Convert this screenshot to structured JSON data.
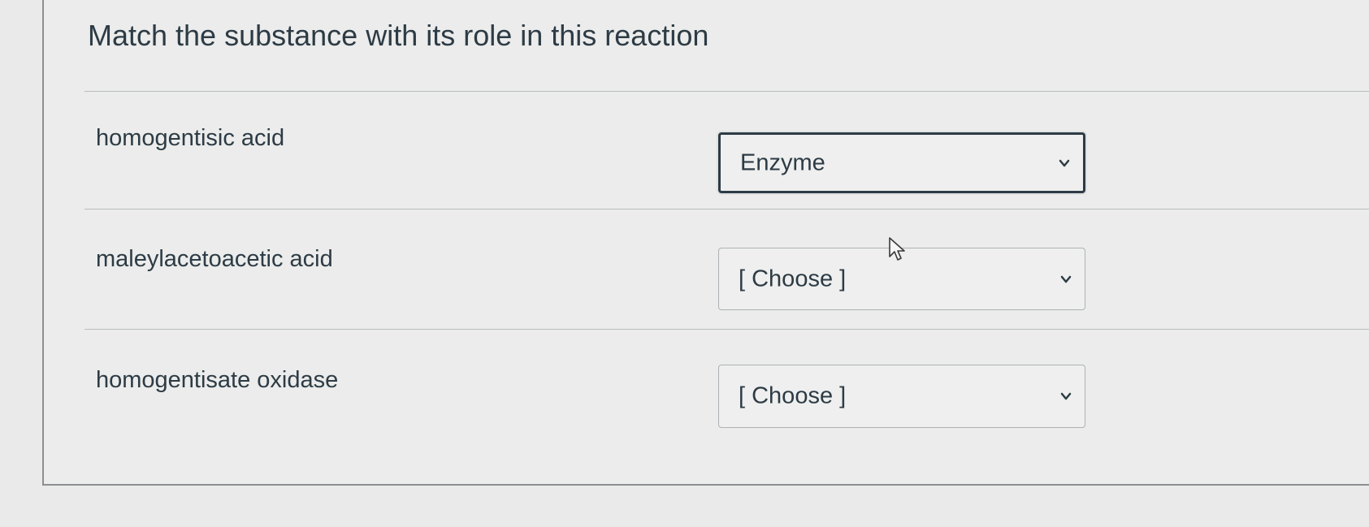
{
  "question": {
    "title": "Match the substance with its role in this reaction"
  },
  "rows": [
    {
      "label": "homogentisic acid",
      "selected": "Enzyme"
    },
    {
      "label": "maleylacetoacetic acid",
      "selected": "[ Choose ]"
    },
    {
      "label": "homogentisate oxidase",
      "selected": "[ Choose ]"
    }
  ],
  "icons": {
    "dropdown": "chevron-down-icon",
    "pointer": "mouse-cursor-icon"
  },
  "colors": {
    "text": "#2d3b45",
    "background": "#e9eae9",
    "select_border": "#aeb2b5",
    "focus_border": "#2d3b45"
  }
}
